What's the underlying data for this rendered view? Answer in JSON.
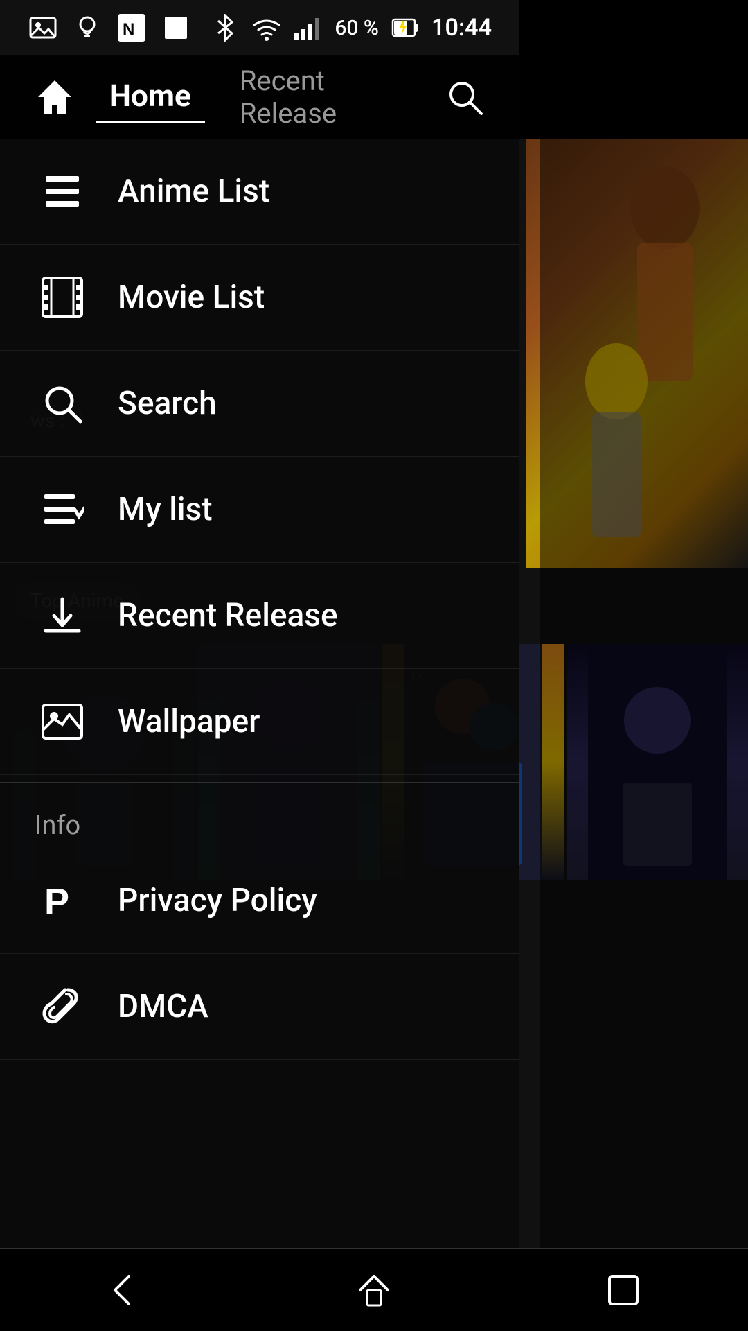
{
  "statusBar": {
    "battery": "60 %",
    "time": "10:44"
  },
  "appBar": {
    "homeIcon": "🏠",
    "tabs": [
      {
        "label": "Home",
        "active": true
      },
      {
        "label": "Recent Release",
        "active": false
      }
    ]
  },
  "drawer": {
    "homeLabel": "Home",
    "menuItems": [
      {
        "id": "anime-list",
        "label": "Anime List",
        "icon": "list"
      },
      {
        "id": "movie-list",
        "label": "Movie List",
        "icon": "film"
      },
      {
        "id": "search",
        "label": "Search",
        "icon": "search"
      },
      {
        "id": "my-list",
        "label": "My list",
        "icon": "mylist"
      },
      {
        "id": "recent-release",
        "label": "Recent Release",
        "icon": "download"
      },
      {
        "id": "wallpaper",
        "label": "Wallpaper",
        "icon": "wallpaper"
      }
    ],
    "infoLabel": "Info",
    "infoItems": [
      {
        "id": "privacy-policy",
        "label": "Privacy Policy",
        "icon": "privacy"
      },
      {
        "id": "dmca",
        "label": "DMCA",
        "icon": "attach"
      }
    ]
  },
  "floatingTags": [
    "Top Anime"
  ],
  "bottomNav": {
    "back": "◁",
    "home": "△",
    "recents": "□"
  }
}
